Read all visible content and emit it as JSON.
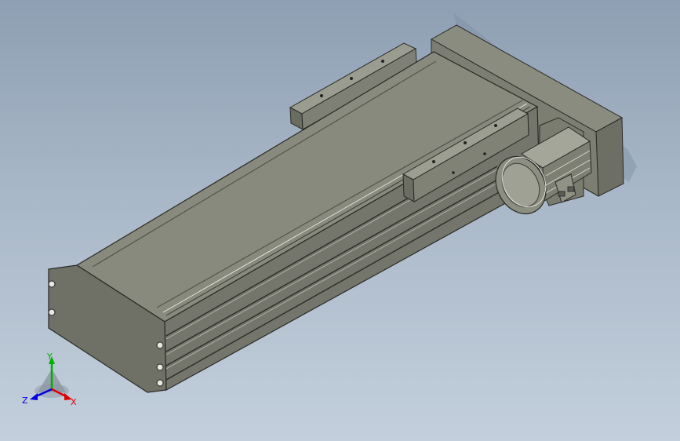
{
  "viewport": {
    "background_top": "#8e9fb3",
    "background_bottom": "#c3cfdc"
  },
  "triad": {
    "x_label": "X",
    "y_label": "Y",
    "z_label": "Z",
    "x_color": "#e00000",
    "y_color": "#00b000",
    "z_color": "#0000e0"
  }
}
